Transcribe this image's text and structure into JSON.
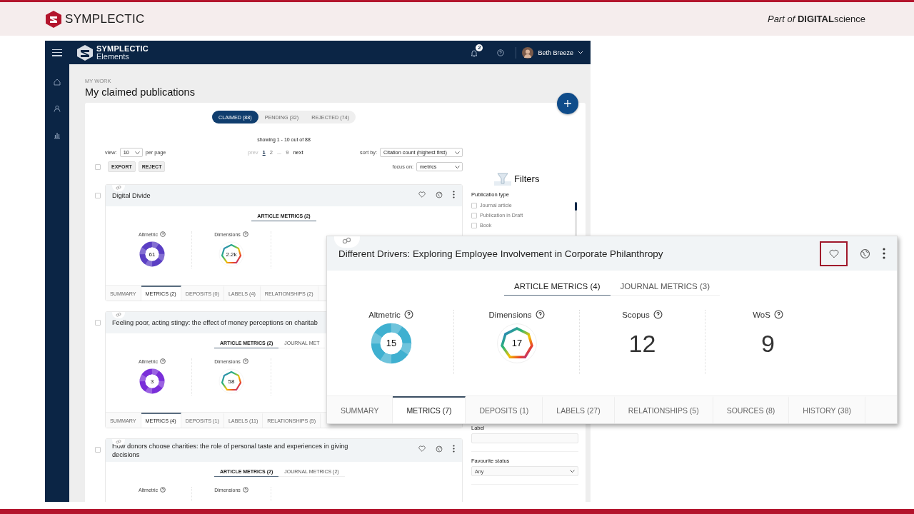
{
  "banner": {
    "brand": "SYMPLECTIC",
    "tagline": "*Part of* **DIGITAL**science"
  },
  "app_header": {
    "logo_line_1": "SYMPLECTIC",
    "logo_line_2": "Elements",
    "notification_count": "2",
    "user": "Beth Breeze"
  },
  "page": {
    "breadcrumb": "MY WORK",
    "title": "My claimed publications"
  },
  "status_tabs": [
    {
      "label": "CLAIMED (88)",
      "selected": true
    },
    {
      "label": "PENDING (32)",
      "selected": false
    },
    {
      "label": "REJECTED (74)",
      "selected": false
    }
  ],
  "summary": "showing 1 - 10 out of 88",
  "view": {
    "label": "view:",
    "value": "10",
    "suffix": "per page"
  },
  "pagination": [
    {
      "label": "prev",
      "kind": "nav",
      "disabled": true
    },
    {
      "label": "1",
      "kind": "page",
      "selected": true
    },
    {
      "label": "2",
      "kind": "page",
      "selected": false
    },
    {
      "label": "...",
      "kind": "gap"
    },
    {
      "label": "9",
      "kind": "page",
      "selected": false
    },
    {
      "label": "next",
      "kind": "nav",
      "disabled": false
    }
  ],
  "sort": {
    "label": "sort by:",
    "value": "Citation count (highest first)"
  },
  "focus": {
    "label": "focus on:",
    "value": "metrics"
  },
  "select_all_checked": false,
  "actions": [
    "EXPORT",
    "REJECT"
  ],
  "publications": [
    {
      "title": "Digital Divide",
      "checked": false,
      "action_icons": true,
      "metric_tabs": [
        {
          "label": "ARTICLE METRICS (2)",
          "selected": true
        }
      ],
      "metrics": [
        {
          "label": "Altmetric",
          "kind": "altmetric",
          "value": "61",
          "color": "#5b3fc4"
        },
        {
          "label": "Dimensions",
          "kind": "dimensions",
          "value": "2.2k"
        }
      ],
      "tabs": [
        {
          "label": "SUMMARY",
          "selected": false
        },
        {
          "label": "METRICS (2)",
          "selected": true
        },
        {
          "label": "DEPOSITS (0)",
          "selected": false
        },
        {
          "label": "LABELS (4)",
          "selected": false
        },
        {
          "label": "RELATIONSHIPS (2)",
          "selected": false
        }
      ]
    },
    {
      "title": "Feeling poor, acting stingy: the effect of money perceptions on charitab",
      "checked": false,
      "action_icons": false,
      "metric_tabs": [
        {
          "label": "ARTICLE METRICS (2)",
          "selected": true
        },
        {
          "label": "JOURNAL MET",
          "selected": false
        }
      ],
      "metrics": [
        {
          "label": "Altmetric",
          "kind": "altmetric",
          "value": "3",
          "color": "#7a2fd9"
        },
        {
          "label": "Dimensions",
          "kind": "dimensions",
          "value": "58"
        }
      ],
      "tabs": [
        {
          "label": "SUMMARY",
          "selected": false
        },
        {
          "label": "METRICS (4)",
          "selected": true
        },
        {
          "label": "DEPOSITS (1)",
          "selected": false
        },
        {
          "label": "LABELS (11)",
          "selected": false
        },
        {
          "label": "RELATIONSHIPS (5)",
          "selected": false
        }
      ]
    },
    {
      "title": "How donors choose charities: the role of personal taste and experiences in giving decisions",
      "checked": false,
      "action_icons": true,
      "metric_tabs": [
        {
          "label": "ARTICLE METRICS (2)",
          "selected": true
        },
        {
          "label": "JOURNAL METRICS (2)",
          "selected": false
        }
      ],
      "metrics": [
        {
          "label": "Altmetric"
        },
        {
          "label": "Dimensions"
        }
      ]
    }
  ],
  "filters": {
    "title": "Filters",
    "publication_type": {
      "label": "Publication type",
      "options": [
        {
          "label": "Journal article",
          "checked": false
        },
        {
          "label": "Publication in Draft",
          "checked": false
        },
        {
          "label": "Book",
          "checked": false
        }
      ]
    },
    "label_field": {
      "label": "Label"
    },
    "favourite_status": {
      "label": "Favourite status",
      "value": "Any"
    }
  },
  "popup": {
    "title": "Different Drivers: Exploring Employee Involvement in Corporate Philanthropy",
    "favourite_highlighted": true,
    "metric_tabs": [
      {
        "label": "ARTICLE METRICS (4)",
        "selected": true
      },
      {
        "label": "JOURNAL METRICS (3)",
        "selected": false
      }
    ],
    "metrics": [
      {
        "label": "Altmetric",
        "kind": "altmetric",
        "value": "15",
        "color": "#3fb0d0"
      },
      {
        "label": "Dimensions",
        "kind": "dimensions",
        "value": "17"
      },
      {
        "label": "Scopus",
        "kind": "number",
        "value": "12"
      },
      {
        "label": "WoS",
        "kind": "number",
        "value": "9"
      }
    ],
    "tabs": [
      {
        "label": "SUMMARY",
        "selected": false
      },
      {
        "label": "METRICS (7)",
        "selected": true
      },
      {
        "label": "DEPOSITS (1)",
        "selected": false
      },
      {
        "label": "LABELS (27)",
        "selected": false
      },
      {
        "label": "RELATIONSHIPS (5)",
        "selected": false
      },
      {
        "label": "SOURCES (8)",
        "selected": false
      },
      {
        "label": "HISTORY (38)",
        "selected": false
      }
    ]
  }
}
